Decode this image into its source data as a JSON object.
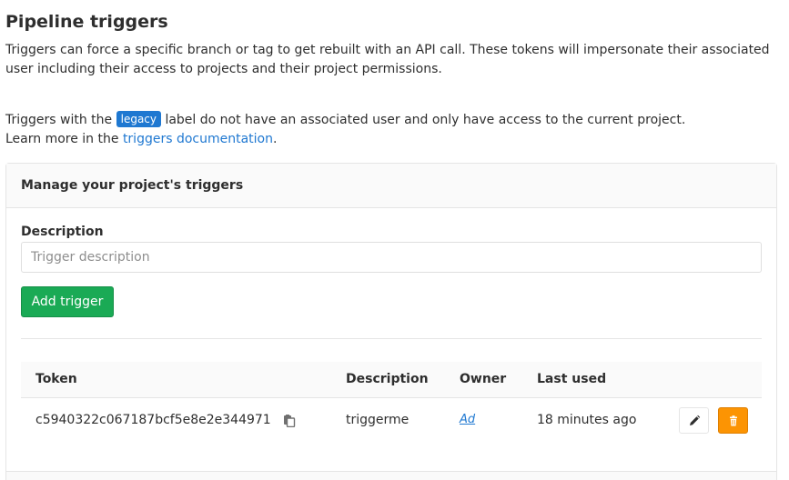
{
  "page": {
    "title": "Pipeline triggers",
    "intro": "Triggers can force a specific branch or tag to get rebuilt with an API call. These tokens will impersonate their associated user including their access to projects and their project permissions.",
    "legacy_prefix": "Triggers with the ",
    "legacy_badge": "legacy",
    "legacy_suffix": " label do not have an associated user and only have access to the current project.",
    "learn_prefix": "Learn more in the ",
    "learn_link": "triggers documentation",
    "learn_suffix": "."
  },
  "card": {
    "header": "Manage your project's triggers",
    "description_label": "Description",
    "description_placeholder": "Trigger description",
    "add_button": "Add trigger"
  },
  "table": {
    "headers": {
      "token": "Token",
      "description": "Description",
      "owner": "Owner",
      "last_used": "Last used"
    },
    "rows": [
      {
        "token": "c5940322c067187bcf5e8e2e344971",
        "description": "triggerme",
        "owner": "Ad",
        "last_used": "18 minutes ago"
      }
    ]
  },
  "icons": {
    "copy": "clipboard-icon",
    "edit": "pencil-icon",
    "delete": "trash-icon"
  },
  "colors": {
    "link": "#1f78d1",
    "badge": "#1f78d1",
    "success": "#1aaa55",
    "warning": "#fc9403"
  }
}
